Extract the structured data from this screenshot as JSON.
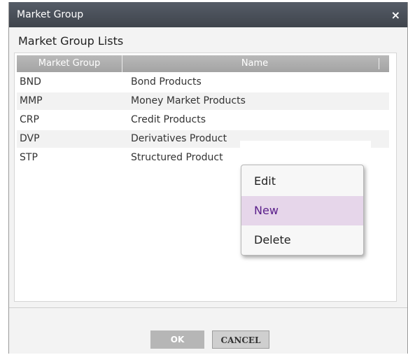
{
  "dialog": {
    "title": "Market Group",
    "close_glyph": "×"
  },
  "section_title": "Market Group Lists",
  "grid": {
    "headers": [
      "Market Group",
      "Name"
    ],
    "rows": [
      {
        "code": "BND",
        "name": "Bond Products"
      },
      {
        "code": "MMP",
        "name": "Money Market Products"
      },
      {
        "code": "CRP",
        "name": "Credit Products"
      },
      {
        "code": "DVP",
        "name": "Derivatives Product"
      },
      {
        "code": "STP",
        "name": "Structured Product"
      }
    ]
  },
  "context_menu": {
    "items": [
      "Edit",
      "New",
      "Delete"
    ],
    "highlighted": "New",
    "highlight_color": "#e6d6ea"
  },
  "buttons": {
    "ok": "OK",
    "cancel": "CANCEL"
  }
}
